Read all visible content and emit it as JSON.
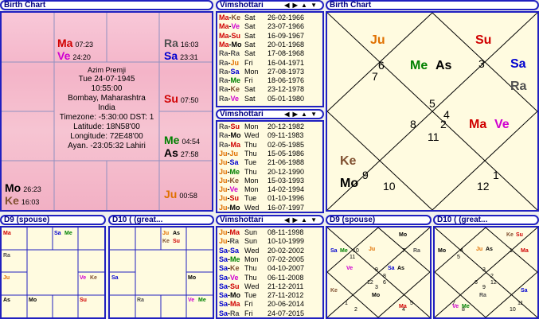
{
  "colors": {
    "Su": "#d00000",
    "Mo": "#000000",
    "Ma": "#d00000",
    "Me": "#008000",
    "Ju": "#e07000",
    "Ve": "#d000d0",
    "Sa": "#0000d0",
    "Ra": "#505050",
    "Ke": "#805030"
  },
  "birth_chart": {
    "title": "Birth Chart",
    "center": [
      "Azim Premji",
      "Tue 24-07-1945",
      "10:55:00",
      "Bombay, Maharashtra",
      "India",
      "Timezone: -5:30:00 DST: 1",
      "Latitude: 18N58'00",
      "Longitude: 72E48'00",
      "Ayan. -23:05:32 Lahiri"
    ],
    "cells": [
      {
        "planets": [
          {
            "p": "Ma",
            "deg": "07:23"
          },
          {
            "p": "Ve",
            "deg": "24:20"
          }
        ]
      },
      {
        "planets": [
          {
            "p": "Ra",
            "deg": "16:03"
          },
          {
            "p": "Sa",
            "deg": "23:31"
          }
        ]
      },
      {
        "planets": [
          {
            "p": "Su",
            "deg": "07:50"
          }
        ]
      },
      {
        "planets": [
          {
            "p": "Me",
            "deg": "04:54"
          },
          {
            "p": "As",
            "deg": "27:58"
          }
        ]
      },
      {
        "planets": [
          {
            "p": "Ju",
            "deg": "00:58"
          }
        ]
      },
      {
        "planets": [
          {
            "p": "Mo",
            "deg": "26:23"
          },
          {
            "p": "Ke",
            "deg": "16:03"
          }
        ]
      }
    ]
  },
  "dasha1": {
    "title": "Vimshottari",
    "arrows": "◀ ▶ ▲ ▼",
    "rows": [
      {
        "p": "Ma-Ke",
        "d": "Sat",
        "t": "26-02-1966"
      },
      {
        "p": "Ma-Ve",
        "d": "Sat",
        "t": "23-07-1966"
      },
      {
        "p": "Ma-Su",
        "d": "Sat",
        "t": "16-09-1967"
      },
      {
        "p": "Ma-Mo",
        "d": "Sat",
        "t": "20-01-1968"
      },
      {
        "p": "Ra-Ra",
        "d": "Sat",
        "t": "17-08-1968"
      },
      {
        "p": "Ra-Ju",
        "d": "Fri",
        "t": "16-04-1971"
      },
      {
        "p": "Ra-Sa",
        "d": "Mon",
        "t": "27-08-1973"
      },
      {
        "p": "Ra-Me",
        "d": "Fri",
        "t": "18-06-1976"
      },
      {
        "p": "Ra-Ke",
        "d": "Sat",
        "t": "23-12-1978"
      },
      {
        "p": "Ra-Ve",
        "d": "Sat",
        "t": "05-01-1980"
      }
    ]
  },
  "dasha2": {
    "title": "Vimshottari",
    "arrows": "◀ ▶ ▲ ▼",
    "rows": [
      {
        "p": "Ra-Su",
        "d": "Mon",
        "t": "20-12-1982"
      },
      {
        "p": "Ra-Mo",
        "d": "Wed",
        "t": "09-11-1983"
      },
      {
        "p": "Ra-Ma",
        "d": "Thu",
        "t": "02-05-1985"
      },
      {
        "p": "Ju-Ju",
        "d": "Thu",
        "t": "15-05-1986"
      },
      {
        "p": "Ju-Sa",
        "d": "Tue",
        "t": "21-06-1988"
      },
      {
        "p": "Ju-Me",
        "d": "Thu",
        "t": "20-12-1990"
      },
      {
        "p": "Ju-Ke",
        "d": "Mon",
        "t": "15-03-1993"
      },
      {
        "p": "Ju-Ve",
        "d": "Mon",
        "t": "14-02-1994"
      },
      {
        "p": "Ju-Su",
        "d": "Tue",
        "t": "01-10-1996"
      },
      {
        "p": "Ju-Mo",
        "d": "Wed",
        "t": "16-07-1997"
      }
    ]
  },
  "dasha3": {
    "title": "Vimshottari",
    "arrows": "◀ ▶ ▲ ▼",
    "rows": [
      {
        "p": "Ju-Ma",
        "d": "Sun",
        "t": "08-11-1998"
      },
      {
        "p": "Ju-Ra",
        "d": "Sun",
        "t": "10-10-1999"
      },
      {
        "p": "Sa-Sa",
        "d": "Wed",
        "t": "20-02-2002"
      },
      {
        "p": "Sa-Me",
        "d": "Mon",
        "t": "07-02-2005"
      },
      {
        "p": "Sa-Ke",
        "d": "Thu",
        "t": "04-10-2007"
      },
      {
        "p": "Sa-Ve",
        "d": "Thu",
        "t": "06-11-2008"
      },
      {
        "p": "Sa-Su",
        "d": "Wed",
        "t": "21-12-2011"
      },
      {
        "p": "Sa-Mo",
        "d": "Tue",
        "t": "27-11-2012"
      },
      {
        "p": "Sa-Ma",
        "d": "Fri",
        "t": "20-06-2014"
      },
      {
        "p": "Sa-Ra",
        "d": "Fri",
        "t": "24-07-2015"
      }
    ]
  },
  "north_chart": {
    "title": "Birth Chart",
    "houses": [
      {
        "n": "5",
        "pl": [
          {
            "p": "Me",
            "x": 0
          },
          {
            "p": "As",
            "x": 0
          }
        ]
      },
      {
        "n": "4",
        "pl": [
          {
            "p": "Su",
            "x": 0
          }
        ]
      },
      {
        "n": "3",
        "pl": [
          {
            "p": "Sa",
            "x": 0
          },
          {
            "p": "Ra",
            "x": 0
          }
        ]
      },
      {
        "n": "2",
        "pl": [
          {
            "p": "Ma",
            "x": 0
          },
          {
            "p": "Ve",
            "x": 0
          }
        ]
      },
      {
        "n": "1",
        "pl": []
      },
      {
        "n": "12",
        "pl": []
      },
      {
        "n": "11",
        "pl": []
      },
      {
        "n": "10",
        "pl": []
      },
      {
        "n": "9",
        "pl": [
          {
            "p": "Ke",
            "x": 0
          },
          {
            "p": "Mo",
            "x": 0
          }
        ]
      },
      {
        "n": "8",
        "pl": []
      },
      {
        "n": "7",
        "pl": []
      },
      {
        "n": "6",
        "pl": [
          {
            "p": "Ju",
            "x": 0
          }
        ]
      }
    ]
  },
  "d9_south": {
    "title": "D9  (spouse)",
    "cells": [
      {
        "pl": [
          "Ma"
        ]
      },
      {
        "pl": []
      },
      {
        "pl": [
          "Sa",
          "Me"
        ]
      },
      {
        "pl": []
      },
      {
        "pl": [
          "Ra"
        ]
      },
      {
        "pl": []
      },
      {
        "pl": [
          "Ju"
        ]
      },
      {
        "pl": [
          "Ve",
          "Ke"
        ]
      },
      {
        "pl": [
          "As"
        ]
      },
      {
        "pl": [
          "Mo"
        ]
      },
      {
        "pl": []
      },
      {
        "pl": [
          "Su"
        ]
      }
    ]
  },
  "d10_south": {
    "title": "D10 ( (great...",
    "cells": [
      {
        "pl": []
      },
      {
        "pl": []
      },
      {
        "pl": [
          "Ju",
          "As",
          "Ke",
          "Su"
        ]
      },
      {
        "pl": []
      },
      {
        "pl": []
      },
      {
        "pl": []
      },
      {
        "pl": [
          "Sa"
        ]
      },
      {
        "pl": [
          "Mo"
        ]
      },
      {
        "pl": []
      },
      {
        "pl": [
          "Ra"
        ]
      },
      {
        "pl": []
      },
      {
        "pl": [
          "Ve",
          "Me"
        ]
      }
    ]
  },
  "d9_north": {
    "title": "D9  (spouse)",
    "nums": [
      "9",
      "8",
      "7",
      "6",
      "5",
      "4",
      "3",
      "2",
      "1",
      "12",
      "11",
      "10"
    ],
    "planets": [
      [
        "Ju"
      ],
      [
        "Mo"
      ],
      [
        "Ra"
      ],
      [
        "Sa",
        "As"
      ],
      [],
      [
        "Ma"
      ],
      [
        "Mo"
      ],
      [],
      [
        "Ke"
      ],
      [
        "Ve"
      ],
      [
        "Sa",
        "Me"
      ],
      []
    ]
  },
  "d10_north": {
    "title": "D10 ( (great...",
    "nums": [
      "3",
      "2",
      "1",
      "12",
      "11",
      "10",
      "9",
      "8",
      "7",
      "6",
      "5",
      "4"
    ],
    "planets": [
      [
        "Ju",
        "As"
      ],
      [
        "Ke",
        "Su"
      ],
      [
        "Ma"
      ],
      [],
      [
        "Sa"
      ],
      [],
      [
        "Ra"
      ],
      [
        "Ve",
        "Me"
      ],
      [],
      [],
      [
        "Mo"
      ],
      []
    ]
  }
}
